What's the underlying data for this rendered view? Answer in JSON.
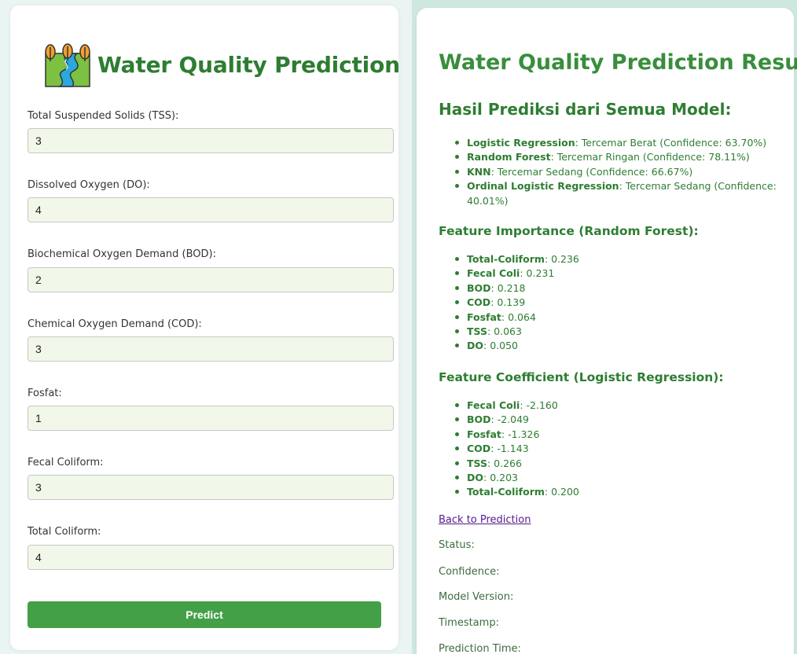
{
  "form": {
    "title": "Water Quality Prediction",
    "fields": [
      {
        "label": "Total Suspended Solids (TSS):",
        "value": "3"
      },
      {
        "label": "Dissolved Oxygen (DO):",
        "value": "4"
      },
      {
        "label": "Biochemical Oxygen Demand (BOD):",
        "value": "2"
      },
      {
        "label": "Chemical Oxygen Demand (COD):",
        "value": "3"
      },
      {
        "label": "Fosfat:",
        "value": "1"
      },
      {
        "label": "Fecal Coliform:",
        "value": "3"
      },
      {
        "label": "Total Coliform:",
        "value": "4"
      }
    ],
    "predict_label": "Predict"
  },
  "result": {
    "title": "Water Quality Prediction Result",
    "models_heading": "Hasil Prediksi dari Semua Model:",
    "models": [
      {
        "name": "Logistic Regression",
        "detail": ": Tercemar Berat (Confidence: 63.70%)"
      },
      {
        "name": "Random Forest",
        "detail": ": Tercemar Ringan (Confidence: 78.11%)"
      },
      {
        "name": "KNN",
        "detail": ": Tercemar Sedang (Confidence: 66.67%)"
      },
      {
        "name": "Ordinal Logistic Regression",
        "detail": ": Tercemar Sedang (Confidence: 40.01%)"
      }
    ],
    "importance_heading": "Feature Importance (Random Forest):",
    "importance": [
      {
        "name": "Total-Coliform",
        "detail": ": 0.236"
      },
      {
        "name": "Fecal Coli",
        "detail": ": 0.231"
      },
      {
        "name": "BOD",
        "detail": ": 0.218"
      },
      {
        "name": "COD",
        "detail": ": 0.139"
      },
      {
        "name": "Fosfat",
        "detail": ": 0.064"
      },
      {
        "name": "TSS",
        "detail": ": 0.063"
      },
      {
        "name": "DO",
        "detail": ": 0.050"
      }
    ],
    "coefficient_heading": "Feature Coefficient (Logistic Regression):",
    "coefficients": [
      {
        "name": "Fecal Coli",
        "detail": ": -2.160"
      },
      {
        "name": "BOD",
        "detail": ": -2.049"
      },
      {
        "name": "Fosfat",
        "detail": ": -1.326"
      },
      {
        "name": "COD",
        "detail": ": -1.143"
      },
      {
        "name": "TSS",
        "detail": ": 0.266"
      },
      {
        "name": "DO",
        "detail": ": 0.203"
      },
      {
        "name": "Total-Coliform",
        "detail": ": 0.200"
      }
    ],
    "back_link": "Back to Prediction",
    "status_labels": [
      "Status:",
      "Confidence:",
      "Model Version:",
      "Timestamp:",
      "Prediction Time:"
    ]
  },
  "colors": {
    "brand_green": "#2e7d32",
    "button_green": "#43a047",
    "input_bg": "#f1f8e9",
    "link_visited": "#551a8b"
  },
  "icons": {
    "logo": "river-trees-icon"
  }
}
